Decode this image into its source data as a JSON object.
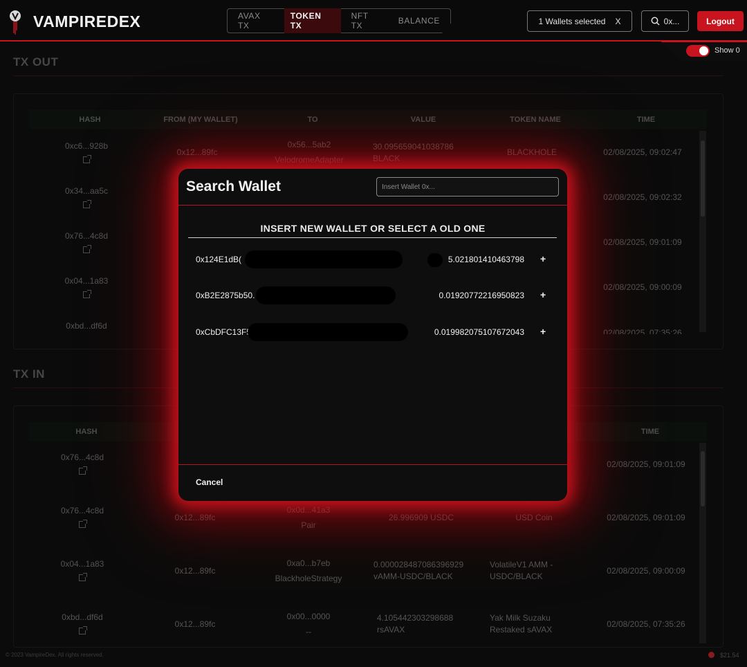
{
  "header": {
    "brand": "VAMPIREDEX",
    "tabs": [
      {
        "label": "AVAX TX",
        "active": false
      },
      {
        "label": "TOKEN TX",
        "active": true
      },
      {
        "label": "NFT TX",
        "active": false
      },
      {
        "label": "BALANCE",
        "active": false
      }
    ],
    "wallets_selected": "1 Wallets selected",
    "wallets_clear": "X",
    "search_label": "0x...",
    "logout_label": "Logout",
    "show_label": "Show 0",
    "accent": "#c8141e"
  },
  "tx_out": {
    "title": "TX OUT",
    "columns": [
      "HASH",
      "FROM (MY WALLET)",
      "TO",
      "VALUE",
      "TOKEN NAME",
      "TIME"
    ],
    "rows": [
      {
        "hash": "0xc6...928b",
        "from": "0x12...89fc",
        "to": "0x56...5ab2",
        "to_name": "VelodromeAdapter",
        "value": "30.095659041038786",
        "value_token": "BLACK",
        "token_name": "BLACKHOLE",
        "time": "02/08/2025, 09:02:47"
      },
      {
        "hash": "0x34...aa5c",
        "time": "02/08/2025, 09:02:32"
      },
      {
        "hash": "0x76...4c8d",
        "time": "02/08/2025, 09:01:09"
      },
      {
        "hash": "0x04...1a83",
        "time": "02/08/2025, 09:00:09"
      },
      {
        "hash": "0xbd...df6d",
        "time": "02/08/2025, 07:35:26"
      }
    ]
  },
  "tx_in": {
    "title": "TX IN",
    "columns": [
      "HASH",
      "TIME"
    ],
    "rows": [
      {
        "hash": "0x76...4c8d",
        "time": "02/08/2025, 09:01:09"
      },
      {
        "hash": "0x76...4c8d",
        "from": "0x12...89fc",
        "to": "0x0d...41a3",
        "to_name": "Pair",
        "value": "26.996909 USDC",
        "token_name": "USD Coin",
        "time": "02/08/2025, 09:01:09"
      },
      {
        "hash": "0x04...1a83",
        "from": "0x12...89fc",
        "to": "0xa0...b7eb",
        "to_name": "BlackholeStrategy",
        "value": "0.000028487086396929",
        "value_token": "vAMM-USDC/BLACK",
        "token_name": "VolatileV1 AMM -",
        "token_name2": "USDC/BLACK",
        "time": "02/08/2025, 09:00:09"
      },
      {
        "hash": "0xbd...df6d",
        "from": "0x12...89fc",
        "to": "0x00...0000",
        "to_name": "--",
        "value": "4.105442303298688",
        "value_token": "rsAVAX",
        "token_name": "Yak Milk Suzaku",
        "token_name2": "Restaked sAVAX",
        "time": "02/08/2025, 07:35:26"
      }
    ]
  },
  "modal": {
    "title": "Search Wallet",
    "input_placeholder": "Insert Wallet 0x...",
    "heading": "INSERT NEW WALLET OR SELECT A OLD ONE",
    "wallets": [
      {
        "address": "0x124E1dB(",
        "balance": "5.021801410463798",
        "add": "+"
      },
      {
        "address": "0xB2E2875b50.",
        "balance": "0.01920772216950823",
        "add": "+"
      },
      {
        "address": "0xCbDFC13F5",
        "balance": "0.019982075107672043",
        "add": "+"
      }
    ],
    "cancel_label": "Cancel"
  },
  "footer": {
    "copyright": "© 2023 VampireDex. All rights reserved.",
    "gas": "$21.54"
  }
}
